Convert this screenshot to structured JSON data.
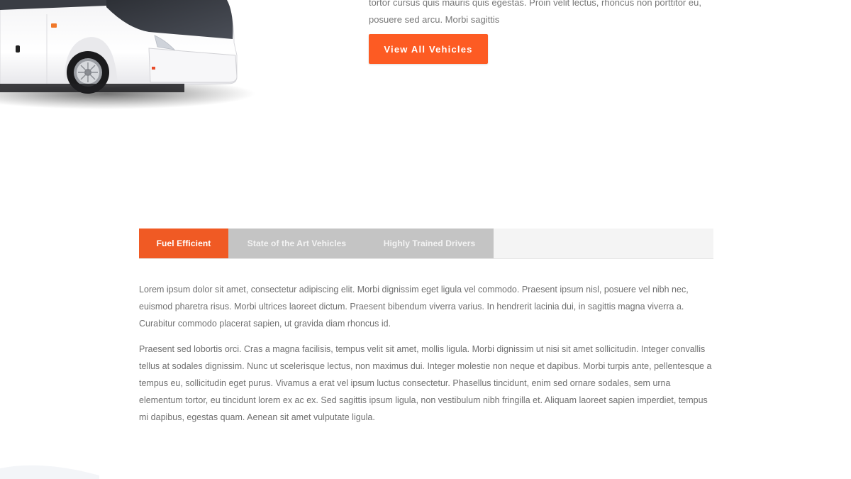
{
  "hero": {
    "text_line_1": "tortor cursus quis mauris quis egestas. Proin velit lectus, rhoncus non porttitor eu,",
    "text_line_2": "posuere sed arcu. Morbi sagittis",
    "cta_label": "View All Vehicles"
  },
  "tabs": [
    {
      "label": "Fuel Efficient",
      "active": true
    },
    {
      "label": "State of the Art Vehicles",
      "active": false
    },
    {
      "label": "Highly Trained Drivers",
      "active": false
    }
  ],
  "tab_content": {
    "paragraph_1": "Lorem ipsum dolor sit amet, consectetur adipiscing elit. Morbi dignissim eget ligula vel commodo. Praesent ipsum nisl, posuere vel nibh nec, euismod pharetra risus. Morbi ultrices laoreet dictum. Praesent bibendum viverra varius. In hendrerit lacinia dui, in sagittis magna viverra a. Curabitur commodo placerat sapien, ut gravida diam rhoncus id.",
    "paragraph_2": "Praesent sed lobortis orci. Cras a magna facilisis, tempus velit sit amet, mollis ligula. Morbi dignissim ut nisi sit amet sollicitudin. Integer convallis tellus at sodales dignissim. Nunc ut scelerisque lectus, non maximus dui. Integer molestie non neque et dapibus. Morbi turpis ante, pellentesque a tempus eu, sollicitudin eget purus. Vivamus a erat vel ipsum luctus consectetur. Phasellus tincidunt, enim sed ornare sodales, sem urna elementum tortor, eu tincidunt lorem ex ac ex. Sed sagittis ipsum ligula, non vestibulum nibh fringilla et. Aliquam laoreet sapien imperdiet, tempus mi dapibus, egestas quam. Aenean sit amet vulputate ligula."
  },
  "colors": {
    "accent": "#fd5b23",
    "tab_active": "#f05a24",
    "tab_inactive": "#c4c4c4",
    "tab_bar_bg": "#f4f4f4",
    "body_text": "#707070"
  },
  "icons": {
    "bus_image": "coach-bus-illustration"
  }
}
